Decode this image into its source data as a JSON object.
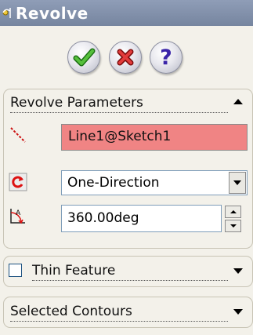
{
  "window": {
    "title": "Revolve"
  },
  "actions": {
    "ok": "ok-icon",
    "cancel": "cancel-icon",
    "help": "?"
  },
  "revolve_parameters": {
    "header": "Revolve Parameters",
    "axis_value": "Line1@Sketch1",
    "direction_selected": "One-Direction",
    "angle_value": "360.00deg"
  },
  "thin_feature": {
    "label": "Thin Feature",
    "checked": false
  },
  "selected_contours": {
    "label": "Selected Contours"
  },
  "colors": {
    "titlebar": "#7f8da8",
    "axis_field_bg": "#f08484",
    "help_glyph": "#3a24a8"
  }
}
